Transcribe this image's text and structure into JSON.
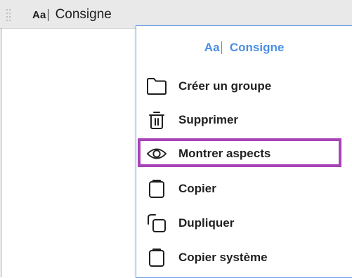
{
  "header": {
    "aa": "Aa",
    "label": "Consigne"
  },
  "menu": {
    "aa": "Aa",
    "title": "Consigne",
    "items": [
      {
        "label": "Créer un groupe",
        "icon": "folder-icon"
      },
      {
        "label": "Supprimer",
        "icon": "trash-icon"
      },
      {
        "label": "Montrer aspects",
        "icon": "eye-icon"
      },
      {
        "label": "Copier",
        "icon": "clipboard-icon"
      },
      {
        "label": "Dupliquer",
        "icon": "duplicate-icon"
      },
      {
        "label": "Copier système",
        "icon": "clipboard-icon"
      }
    ]
  },
  "colors": {
    "accent": "#4a8ee6",
    "highlight": "#a843b8",
    "header_bg": "#e9e9e9"
  }
}
